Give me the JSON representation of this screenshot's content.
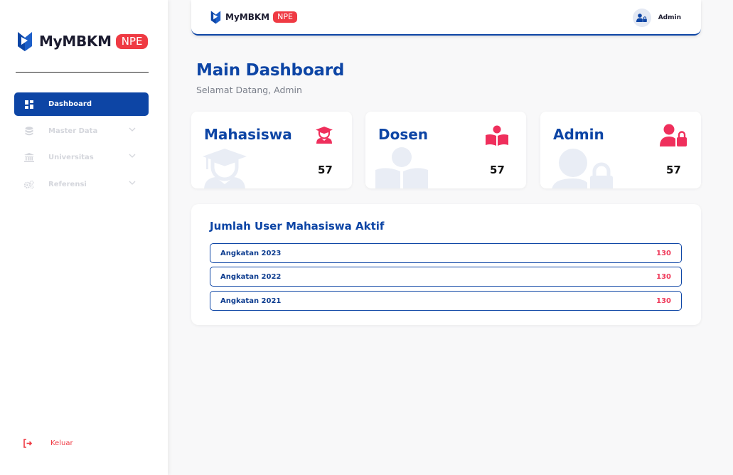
{
  "sidebar": {
    "brand": {
      "name": "MyMBKM",
      "badge": "NPE"
    },
    "items": [
      {
        "label": "Dashboard",
        "icon": "dashboard-grid-icon",
        "active": true
      },
      {
        "label": "Master Data",
        "icon": "database-icon",
        "expandable": true
      },
      {
        "label": "Universitas",
        "icon": "university-building-icon",
        "expandable": true
      },
      {
        "label": "Referensi",
        "icon": "gears-icon",
        "expandable": true
      }
    ],
    "logout": {
      "label": "Keluar",
      "icon": "logout-icon"
    }
  },
  "topbar": {
    "brand": {
      "name": "MyMBKM",
      "badge": "NPE"
    },
    "user": {
      "name": "Admin",
      "icon": "user-lock-icon"
    }
  },
  "header": {
    "title": "Main Dashboard",
    "subtitle": "Selamat Datang, Admin"
  },
  "cards": [
    {
      "title": "Mahasiswa",
      "value": "57",
      "icon": "graduate-icon"
    },
    {
      "title": "Dosen",
      "value": "57",
      "icon": "reader-icon"
    },
    {
      "title": "Admin",
      "value": "57",
      "icon": "user-lock-icon"
    }
  ],
  "active_users": {
    "title": "Jumlah User Mahasiswa Aktif",
    "rows": [
      {
        "label": "Angkatan 2023",
        "value": "130"
      },
      {
        "label": "Angkatan 2022",
        "value": "130"
      },
      {
        "label": "Angkatan 2021",
        "value": "130"
      }
    ]
  },
  "colors": {
    "primary": "#0d45a5",
    "accent": "#ef3a43",
    "value_pink": "#ef3a5a",
    "muted_nav": "#d4d6dc"
  }
}
